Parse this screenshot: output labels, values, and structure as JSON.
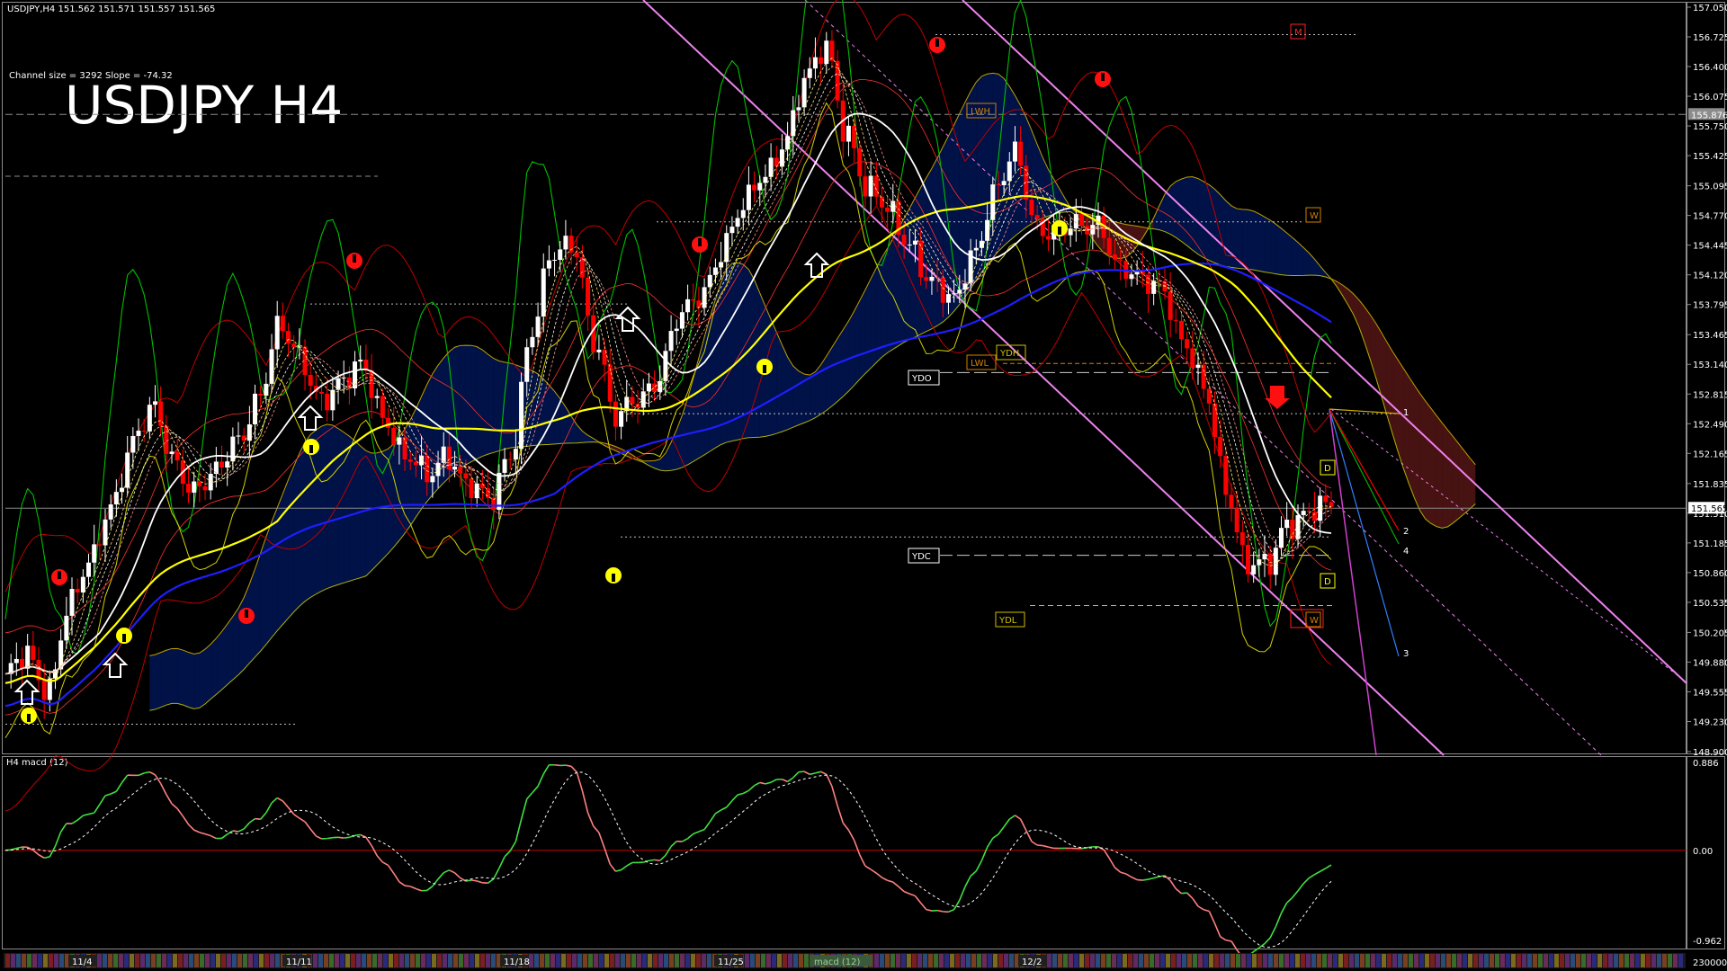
{
  "window": {
    "header": "USDJPY,H4  151.562 151.571 151.557 151.565",
    "channel_info": "Channel size = 3292 Slope = -74.32",
    "big_title": "USDJPY H4",
    "macd_label": "H4  macd (12)"
  },
  "price_axis": {
    "ticks": [
      "157.050",
      "156.725",
      "156.400",
      "156.075",
      "155.750",
      "155.425",
      "155.095",
      "154.770",
      "154.445",
      "154.120",
      "153.795",
      "153.465",
      "153.140",
      "152.815",
      "152.490",
      "152.165",
      "151.835",
      "151.510",
      "151.185",
      "150.860",
      "150.535",
      "150.205",
      "149.880",
      "149.555",
      "149.230",
      "148.900"
    ],
    "current_price": "151.565",
    "marker_price": "155.876"
  },
  "macd_axis": {
    "top": "0.886",
    "zero": "0.00",
    "bottom": "-0.962",
    "volume": "230000"
  },
  "date_labels": [
    "11/4",
    "11/11",
    "11/18",
    "11/25",
    "12/2"
  ],
  "level_tags": {
    "ydo": "YDO",
    "ydc": "YDC",
    "ydl": "YDL",
    "ydh": "YDH",
    "lwh": "LWH",
    "lwl": "LWL",
    "m": "M",
    "w1": "W",
    "w2": "W",
    "d1": "D",
    "d2": "D"
  },
  "projection_labels": [
    "1",
    "2",
    "4",
    "3"
  ],
  "bottom_tab": "macd (12)",
  "colors": {
    "bull": "#ffffff",
    "bear": "#ff0000",
    "ma_yellow": "#ffff00",
    "ma_blue": "#1e1eff",
    "ma_white": "#ffffff",
    "channel": "#ee82ee",
    "green_osc": "#00c000",
    "macd_up": "#40e040",
    "macd_down": "#ff8080",
    "cloud_blue": "#0040ff",
    "cloud_red": "#ff4040"
  },
  "chart_data": {
    "type": "candlestick",
    "symbol": "USDJPY",
    "timeframe": "H4",
    "ylim": [
      148.9,
      157.05
    ],
    "x_labels": [
      "11/4",
      "11/11",
      "11/18",
      "11/25",
      "12/2"
    ],
    "close_path": [
      149.75,
      149.9,
      149.6,
      150.5,
      150.9,
      151.6,
      152.3,
      152.6,
      152.1,
      151.8,
      151.9,
      152.3,
      152.8,
      153.5,
      153.2,
      152.8,
      152.9,
      153.1,
      152.6,
      152.1,
      151.9,
      152.2,
      151.8,
      151.6,
      152.2,
      153.5,
      154.3,
      154.5,
      153.4,
      152.5,
      152.8,
      153.0,
      153.6,
      153.9,
      154.4,
      154.8,
      155.2,
      155.6,
      156.2,
      156.6,
      155.7,
      155.0,
      154.8,
      154.5,
      154.0,
      153.8,
      154.4,
      155.0,
      155.4,
      154.7,
      154.6,
      154.6,
      154.7,
      154.2,
      154.0,
      154.0,
      153.4,
      152.8,
      151.8,
      151.0,
      150.9,
      151.4,
      151.6,
      151.57
    ],
    "levels": {
      "ydo": 153.05,
      "ydc": 151.05,
      "ydl": 150.5,
      "ydh": 153.3,
      "lwh": 155.85,
      "lwl": 153.15
    },
    "macd": {
      "ylim": [
        -0.962,
        0.886
      ]
    }
  }
}
